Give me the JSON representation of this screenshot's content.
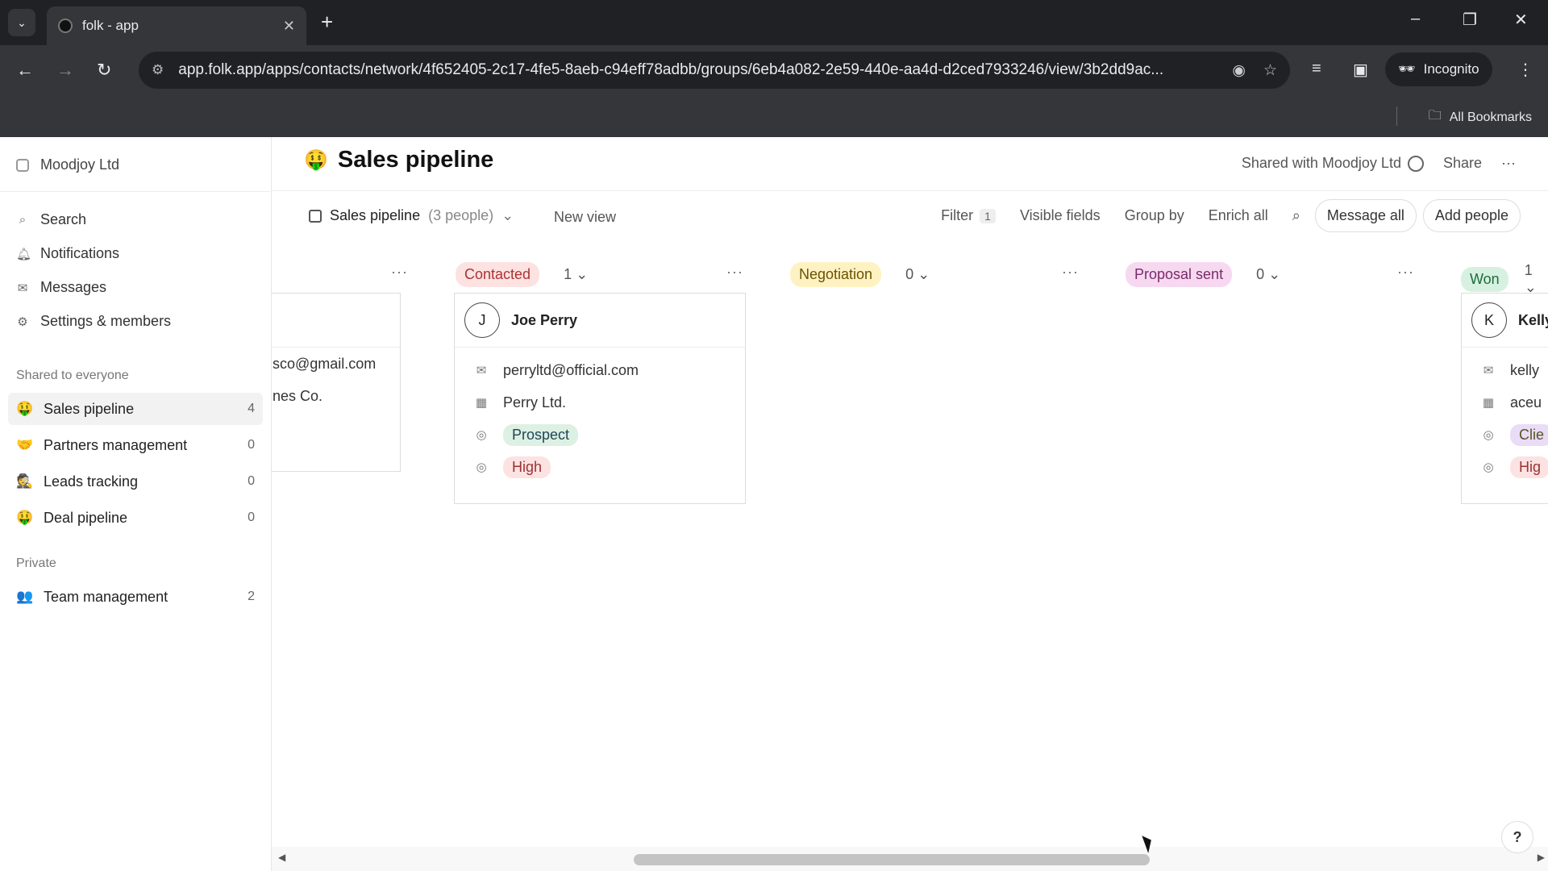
{
  "browser": {
    "tab_title": "folk - app",
    "url": "app.folk.app/apps/contacts/network/4f652405-2c17-4fe5-8aeb-c94eff78adbb/groups/6eb4a082-2e59-440e-aa4d-d2ced7933246/view/3b2dd9ac...",
    "incognito_label": "Incognito",
    "bookmarks_label": "All Bookmarks"
  },
  "sidebar": {
    "workspace": "Moodjoy Ltd",
    "nav": [
      {
        "label": "Search",
        "icon": "search-icon"
      },
      {
        "label": "Notifications",
        "icon": "bell-icon"
      },
      {
        "label": "Messages",
        "icon": "mail-icon"
      },
      {
        "label": "Settings & members",
        "icon": "gear-icon"
      }
    ],
    "shared_heading": "Shared to everyone",
    "shared_groups": [
      {
        "emoji": "🤑",
        "label": "Sales pipeline",
        "count": "4"
      },
      {
        "emoji": "🤝",
        "label": "Partners management",
        "count": "0"
      },
      {
        "emoji": "🕵",
        "label": "Leads tracking",
        "count": "0"
      },
      {
        "emoji": "🤑",
        "label": "Deal pipeline",
        "count": "0"
      }
    ],
    "private_heading": "Private",
    "private_groups": [
      {
        "emoji": "👥",
        "label": "Team management",
        "count": "2"
      }
    ]
  },
  "header": {
    "emoji": "🤑",
    "title": "Sales pipeline",
    "shared_with": "Shared with Moodjoy Ltd",
    "share": "Share",
    "more": "···"
  },
  "viewbar": {
    "view_name": "Sales pipeline",
    "view_people": "(3 people)",
    "new_view": "New view",
    "filter": "Filter",
    "filter_count": "1",
    "visible_fields": "Visible fields",
    "group_by": "Group by",
    "enrich_all": "Enrich all",
    "message_all": "Message all",
    "add_people": "Add people"
  },
  "board": {
    "columns": [
      {
        "stage": "Contacted",
        "count": "1"
      },
      {
        "stage": "Negotiation",
        "count": "0"
      },
      {
        "stage": "Proposal sent",
        "count": "0"
      },
      {
        "stage": "Won",
        "count": "1"
      }
    ],
    "partial_card": {
      "email": "sco@gmail.com",
      "company": "nes Co."
    },
    "joe_card": {
      "initial": "J",
      "name": "Joe Perry",
      "email": "perryltd@official.com",
      "company": "Perry Ltd.",
      "status": "Prospect",
      "priority": "High"
    },
    "kelly_card": {
      "initial": "K",
      "name": "Kelly",
      "email": "kelly",
      "company": "aceu",
      "status": "Clie",
      "priority": "Hig"
    }
  },
  "help": "?"
}
